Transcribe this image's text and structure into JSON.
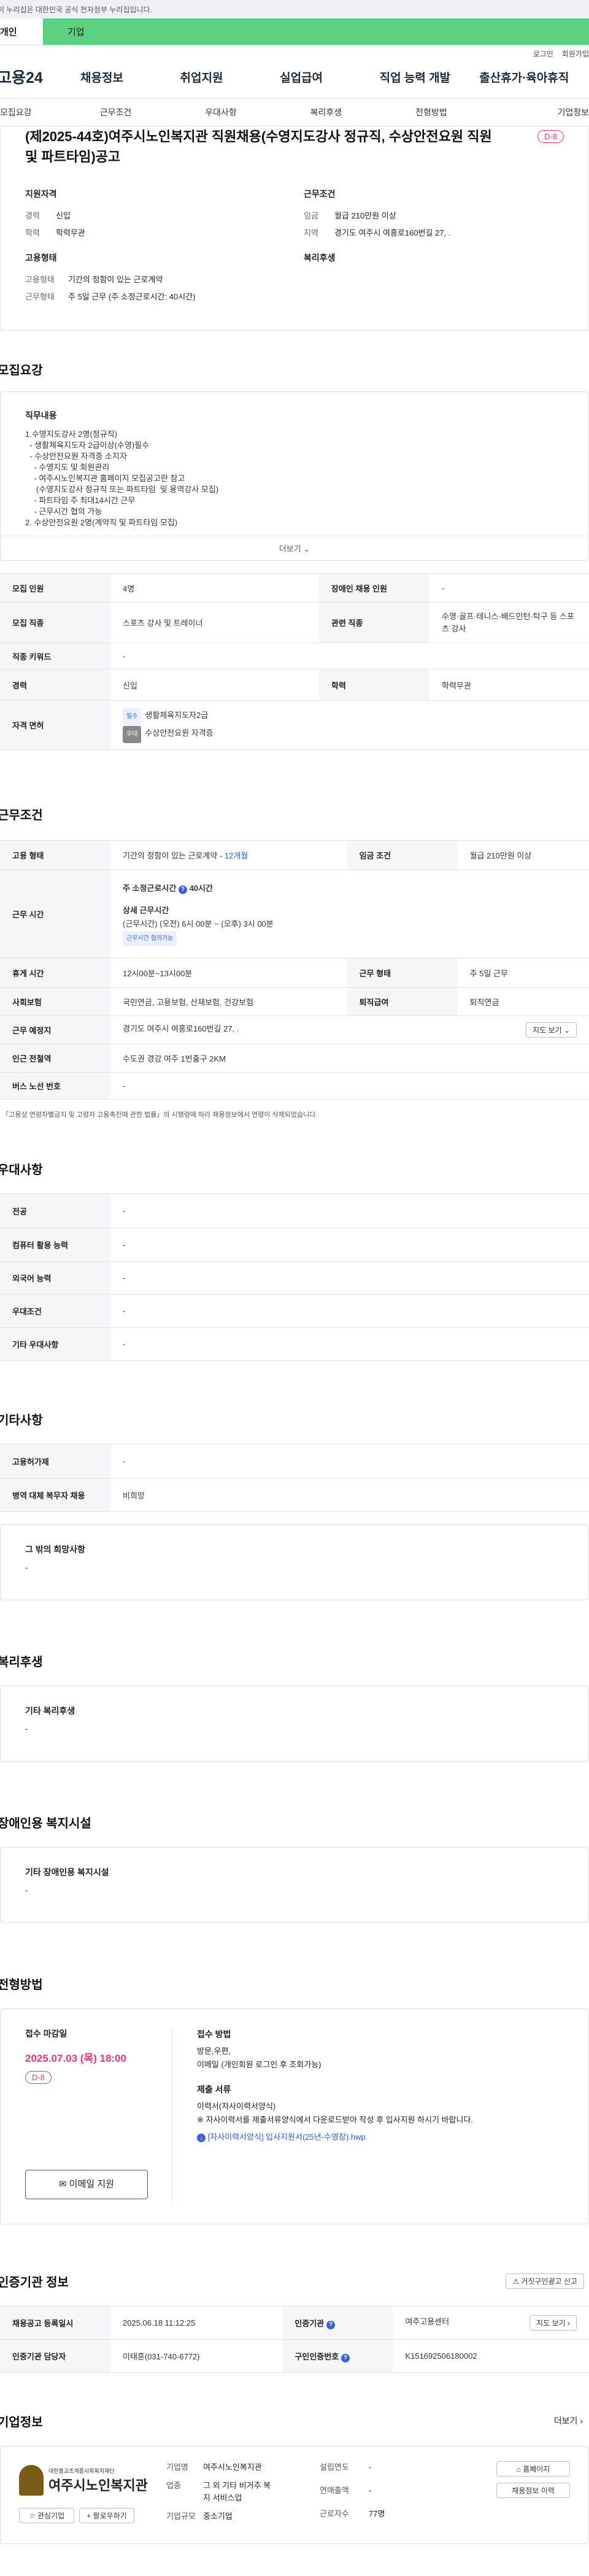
{
  "gov_banner": "이 누리집은 대한민국 공식 전자정부 누리집입니다.",
  "user_tabs": {
    "personal": "개인",
    "company": "기업"
  },
  "util": {
    "login": "로그인",
    "signup": "회원가입"
  },
  "gnb": {
    "logo": "고용24",
    "items": [
      "채용정보",
      "취업지원",
      "실업급여",
      "직업 능력 개발",
      "출산휴가·육아휴직"
    ]
  },
  "subnav": [
    "모집요강",
    "근무조건",
    "우대사항",
    "복리후생",
    "전형방법",
    "기업정보"
  ],
  "hero": {
    "title": "(제2025-44호)여주시노인복지관 직원채용(수영지도강사 정규직, 수상안전요원 직원 및 파트타임)공고",
    "dday": "D-8",
    "left_title": "지원자격",
    "left": [
      {
        "k": "경력",
        "v": "신입"
      },
      {
        "k": "학력",
        "v": "학력무관"
      }
    ],
    "right_title": "근무조건",
    "right": [
      {
        "k": "임금",
        "v": "월급 210만원 이상"
      },
      {
        "k": "지역",
        "v": "경기도 여주시 여흥로160번길 27, ."
      }
    ],
    "left2_title": "고용형태",
    "left2": [
      {
        "k": "고용형태",
        "v": "기간의 정함이 있는 근로계약"
      },
      {
        "k": "근무형태",
        "v": "주 5일 근무 (주 소정근로시간: 40시간)"
      }
    ],
    "right2_title": "복리후생"
  },
  "recruit": {
    "title": "모집요강",
    "duty_title": "직무내용",
    "duty_text": "1.수영지도강사 2명(정규직)\n  - 생활체육지도자 2급이상(수영)필수\n  - 수상안전요원 자격증 소지자\n    - 수영지도 및 회원관리\n    - 여주시노인복지관 홈페이지 모집공고란 참고\n     (수영지도강사 정규직 또는 파트타임  및 용역강사 모집)\n    - 파트타임 주 최대14시간 근무\n    - 근무시간 협의 가능\n2. 수상안전요원 2명(계약직 및 파트타임 모집)",
    "more": "더보기",
    "rows": {
      "count_k": "모집 인원",
      "count_v": "4명",
      "dis_k": "장애인 채용 인원",
      "dis_v": "-",
      "job_k": "모집 직종",
      "job_v": "스포츠 강사 및 트레이너",
      "rel_k": "관련 직종",
      "rel_v": "수영·골프·테니스·배드민턴·탁구 등 스포츠 강사",
      "kw_k": "직종 키워드",
      "kw_v": "-",
      "exp_k": "경력",
      "exp_v": "신입",
      "edu_k": "학력",
      "edu_v": "학력무관",
      "lic_k": "자격 면허",
      "lic1_badge": "필수",
      "lic1": "생활체육지도자2급",
      "lic2_badge": "우대",
      "lic2": "수상안전요원 자격증"
    }
  },
  "work": {
    "title": "근무조건",
    "emp_k": "고용 형태",
    "emp_v": "기간의 정함이 있는 근로계약 - ",
    "emp_link": "12개월",
    "wage_k": "임금 조건",
    "wage_v": "월급 210만원 이상",
    "time_k": "근무 시간",
    "weekly": "주 소정근로시간 ",
    "weekly_hours": "40시간",
    "detail_t": "상세 근무시간",
    "detail_v": "(근무시간) (오전) 6시 00분 ~ (오후) 3시 00분",
    "negot": "근무시간 협의가능",
    "rest_k": "휴게 시간",
    "rest_v": "12시00분~13시00분",
    "shape_k": "근무 형태",
    "shape_v": "주 5일 근무",
    "ins_k": "사회보험",
    "ins_v": "국민연금, 고용보험, 산재보험, 건강보험",
    "sev_k": "퇴직급여",
    "sev_v": "퇴직연금",
    "place_k": "근무 예정지",
    "place_v": "경기도 여주시 여흥로160번길 27, .",
    "map_btn": "지도 보기",
    "subway_k": "인근 전철역",
    "subway_v": "수도권 경강 여주 1번출구 2KM",
    "bus_k": "버스 노선 번호",
    "bus_v": "-",
    "note": "* 「고용상 연령차별금지 및 고령자 고용촉진에 관한 법률」의 시행령에 따라 채용정보에서 연령이 삭제되었습니다."
  },
  "pref": {
    "title": "우대사항",
    "rows": [
      {
        "k": "전공",
        "v": "-"
      },
      {
        "k": "컴퓨터 활용 능력",
        "v": "-"
      },
      {
        "k": "외국어 능력",
        "v": "-"
      },
      {
        "k": "우대조건",
        "v": "-"
      },
      {
        "k": "기타 우대사항",
        "v": "-"
      }
    ]
  },
  "etc": {
    "title": "기타사항",
    "rows": [
      {
        "k": "고용허가제",
        "v": "-"
      },
      {
        "k": "병역 대체 복무자 채용",
        "v": "비희망"
      }
    ],
    "box_t": "그 밖의 희망사항",
    "box_v": "-"
  },
  "welfare": {
    "title": "복리후생",
    "box_t": "기타 복리후생",
    "box_v": "-"
  },
  "disab": {
    "title": "장애인용 복지시설",
    "box_t": "기타 장애인용 복지시설",
    "box_v": "-"
  },
  "process": {
    "title": "전형방법",
    "deadline_t": "접수 마감일",
    "deadline": "2025.07.03 (목) 18:00",
    "dday": "D-8",
    "apply_btn": "이메일 지원",
    "method_t": "접수 방법",
    "method_v": "방문,우편,",
    "method_v2": "이메일 (개인회원 로그인 후 조회가능)",
    "docs_t": "제출 서류",
    "docs_v": "이력서(자사이력서양식)",
    "docs_note": "※ 자사이력서를 제출서류양식에서 다운로드받아 작성 후 입사지원 하시기 바랍니다.",
    "file": "[자사이력서양식] 입사지원서(25년-수영장).hwp"
  },
  "cert": {
    "title": "인증기관 정보",
    "report_btn": "거짓구인광고 신고",
    "reg_k": "채용공고 등록일시",
    "reg_v": "2025.06.18 11:12:25",
    "org_k": "인증기관",
    "org_v": "여주고용센터",
    "map_btn": "지도 보기",
    "mgr_k": "인증기관 담당자",
    "mgr_v": "이태훈(031-740-6772)",
    "num_k": "구인인증번호",
    "num_v": "K151692506180002"
  },
  "company": {
    "title": "기업정보",
    "more": "더보기",
    "logo_l1": "대한불교조계종사회복지재단",
    "logo_l2": "여주시노인복지관",
    "fav_btn": "관심기업",
    "follow_btn": "팔로우하기",
    "name_k": "기업명",
    "name_v": "여주시노인복지관",
    "ind_k": "업종",
    "ind_v": "그 외 기타 비거주 복지 서비스업",
    "size_k": "기업규모",
    "size_v": "중소기업",
    "year_k": "설립연도",
    "year_v": "-",
    "sales_k": "연매출액",
    "sales_v": "-",
    "emp_k": "근로자수",
    "emp_v": "77명",
    "home_btn": "홈페이지",
    "list_btn": "채용정보 이력"
  }
}
